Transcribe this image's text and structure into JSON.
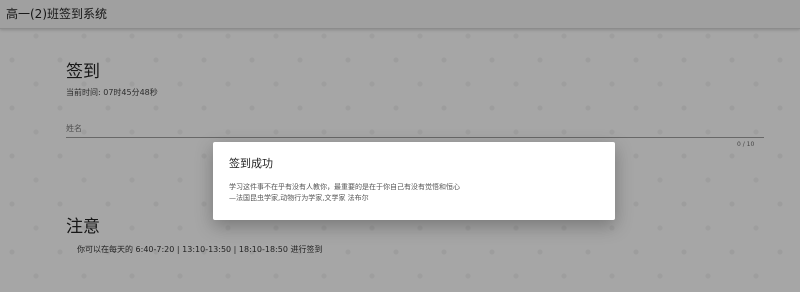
{
  "app": {
    "title": "高一(2)班签到系统"
  },
  "signin": {
    "heading": "签到",
    "current_time_label": "当前时间: 07时45分48秒",
    "name_placeholder": "姓名",
    "char_counter": "0 / 10"
  },
  "notice": {
    "heading": "注意",
    "text": "你可以在每天的 6:40-7:20 | 13:10-13:50 | 18:10-18:50 进行签到"
  },
  "dialog": {
    "title": "签到成功",
    "quote_line1": "学习这件事不在乎有没有人教你，最重要的是在于你自己有没有觉悟和恒心",
    "quote_line2": "—法国昆虫学家,动物行为学家,文学家 法布尔"
  }
}
